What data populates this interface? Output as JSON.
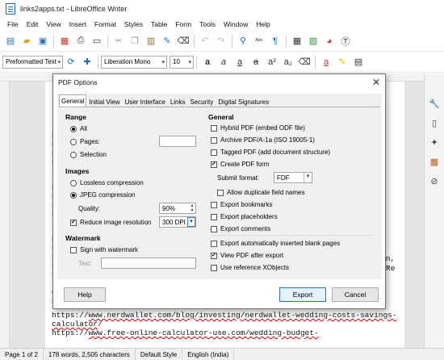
{
  "window": {
    "title": "links2apps.txt - LibreOffice Writer"
  },
  "menu": [
    "File",
    "Edit",
    "View",
    "Insert",
    "Format",
    "Styles",
    "Table",
    "Form",
    "Tools",
    "Window",
    "Help"
  ],
  "toolbar2": {
    "paragraph_style": "Preformatted Text",
    "font_name": "Liberation Mono",
    "font_size": "10"
  },
  "document": {
    "left_chars": [
      "h",
      "h",
      "h",
      "h",
      "h",
      "h",
      "h",
      "h",
      "h",
      "h",
      "h",
      "h",
      "h",
      "C",
      "h"
    ],
    "right_snippets": [
      "on,",
      "Re"
    ],
    "lines": [
      {
        "before": "https://",
        "link": "www.nerdwallet.com/blog/investing/nerdwallet-wedding-costs-savings-",
        "after": ""
      },
      {
        "before": "",
        "link": "calculator",
        "after": "/"
      },
      {
        "before": "https://",
        "link": "www.free-online-calculator-use.com/wedding-budget-",
        "after": ""
      }
    ]
  },
  "dialog": {
    "title": "PDF Options",
    "tabs": [
      "General",
      "Initial View",
      "User Interface",
      "Links",
      "Security",
      "Digital Signatures"
    ],
    "range": {
      "title": "Range",
      "all": "All",
      "pages": "Pages:",
      "selection": "Selection"
    },
    "images": {
      "title": "Images",
      "lossless": "Lossless compression",
      "jpeg": "JPEG compression",
      "quality_label": "Quality:",
      "quality_value": "90%",
      "reduce": "Reduce image resolution",
      "resolution_value": "300 DPI"
    },
    "watermark": {
      "title": "Watermark",
      "sign": "Sign with watermark",
      "text_label": "Text:"
    },
    "general": {
      "title": "General",
      "hybrid": "Hybrid PDF (embed ODF file)",
      "archive": "Archive PDF/A-1a (ISO 19005-1)",
      "tagged": "Tagged PDF (add document structure)",
      "create_form": "Create PDF form",
      "submit_label": "Submit format:",
      "submit_value": "FDF",
      "allow_dup": "Allow duplicate field names",
      "bookmarks": "Export bookmarks",
      "placeholders": "Export placeholders",
      "comments": "Export comments",
      "blank_pages": "Export automatically inserted blank pages",
      "view_after": "View PDF after export",
      "xobjects": "Use reference XObjects"
    },
    "buttons": {
      "help": "Help",
      "export": "Export",
      "cancel": "Cancel"
    }
  },
  "status": {
    "page": "Page 1 of 2",
    "words": "178 words, 2,505 characters",
    "style": "Default Style",
    "language": "English (India)"
  }
}
